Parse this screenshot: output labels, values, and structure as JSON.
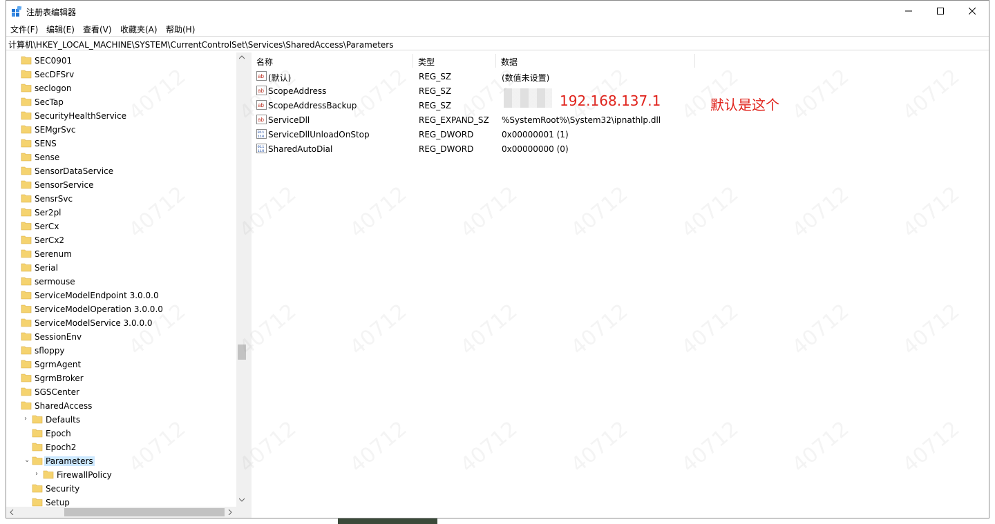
{
  "window": {
    "title": "注册表编辑器"
  },
  "menu": [
    "文件(F)",
    "编辑(E)",
    "查看(V)",
    "收藏夹(A)",
    "帮助(H)"
  ],
  "address": "计算机\\HKEY_LOCAL_MACHINE\\SYSTEM\\CurrentControlSet\\Services\\SharedAccess\\Parameters",
  "tree": [
    {
      "label": "SEC0901",
      "level": 0
    },
    {
      "label": "SecDFSrv",
      "level": 0
    },
    {
      "label": "seclogon",
      "level": 0
    },
    {
      "label": "SecTap",
      "level": 0
    },
    {
      "label": "SecurityHealthService",
      "level": 0
    },
    {
      "label": "SEMgrSvc",
      "level": 0
    },
    {
      "label": "SENS",
      "level": 0
    },
    {
      "label": "Sense",
      "level": 0
    },
    {
      "label": "SensorDataService",
      "level": 0
    },
    {
      "label": "SensorService",
      "level": 0
    },
    {
      "label": "SensrSvc",
      "level": 0
    },
    {
      "label": "Ser2pl",
      "level": 0
    },
    {
      "label": "SerCx",
      "level": 0
    },
    {
      "label": "SerCx2",
      "level": 0
    },
    {
      "label": "Serenum",
      "level": 0
    },
    {
      "label": "Serial",
      "level": 0
    },
    {
      "label": "sermouse",
      "level": 0
    },
    {
      "label": "ServiceModelEndpoint 3.0.0.0",
      "level": 0
    },
    {
      "label": "ServiceModelOperation 3.0.0.0",
      "level": 0
    },
    {
      "label": "ServiceModelService 3.0.0.0",
      "level": 0
    },
    {
      "label": "SessionEnv",
      "level": 0
    },
    {
      "label": "sfloppy",
      "level": 0
    },
    {
      "label": "SgrmAgent",
      "level": 0
    },
    {
      "label": "SgrmBroker",
      "level": 0
    },
    {
      "label": "SGSCenter",
      "level": 0
    },
    {
      "label": "SharedAccess",
      "level": 0
    },
    {
      "label": "Defaults",
      "level": 1,
      "expander": "collapsed"
    },
    {
      "label": "Epoch",
      "level": 1
    },
    {
      "label": "Epoch2",
      "level": 1
    },
    {
      "label": "Parameters",
      "level": 1,
      "expander": "expanded",
      "selected": true
    },
    {
      "label": "FirewallPolicy",
      "level": 2,
      "expander": "collapsed"
    },
    {
      "label": "Security",
      "level": 1
    },
    {
      "label": "Setup",
      "level": 1
    }
  ],
  "columns": [
    "名称",
    "类型",
    "数据"
  ],
  "values": [
    {
      "name": "(默认)",
      "type": "REG_SZ",
      "data": "(数值未设置)",
      "icon": "string-value-icon"
    },
    {
      "name": "ScopeAddress",
      "type": "REG_SZ",
      "data": "",
      "icon": "string-value-icon"
    },
    {
      "name": "ScopeAddressBackup",
      "type": "REG_SZ",
      "data": "",
      "icon": "string-value-icon"
    },
    {
      "name": "ServiceDll",
      "type": "REG_EXPAND_SZ",
      "data": "%SystemRoot%\\System32\\ipnathlp.dll",
      "icon": "string-value-icon"
    },
    {
      "name": "ServiceDllUnloadOnStop",
      "type": "REG_DWORD",
      "data": "0x00000001 (1)",
      "icon": "binary-value-icon"
    },
    {
      "name": "SharedAutoDial",
      "type": "REG_DWORD",
      "data": "0x00000000 (0)",
      "icon": "binary-value-icon"
    }
  ],
  "annotations": {
    "ip": "192.168.137.1",
    "note": "默认是这个",
    "color": "#e0231c"
  },
  "colors": {
    "selection": "#cce8ff",
    "folder": "#f5d36f"
  }
}
